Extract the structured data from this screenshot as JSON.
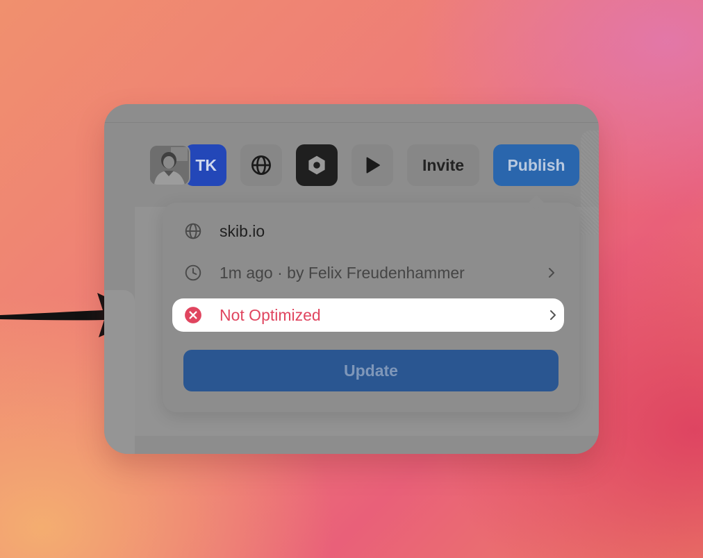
{
  "toolbar": {
    "avatar_initials": "TK",
    "invite_label": "Invite",
    "publish_label": "Publish"
  },
  "publish_menu": {
    "domain": "skib.io",
    "history": "1m ago · by Felix Freudenhammer",
    "status": "Not Optimized",
    "update_label": "Update"
  },
  "icons": {
    "globe": "globe-icon",
    "framer": "framer-hexagon-icon",
    "play": "play-icon",
    "clock": "clock-icon",
    "error": "error-x-circle-icon",
    "chevron": "chevron-right-icon",
    "arrow": "arrow-right-icon"
  },
  "colors": {
    "publish_blue": "#2a66ad",
    "status_error": "#e0455f",
    "avatar_blue": "#2347b8"
  }
}
